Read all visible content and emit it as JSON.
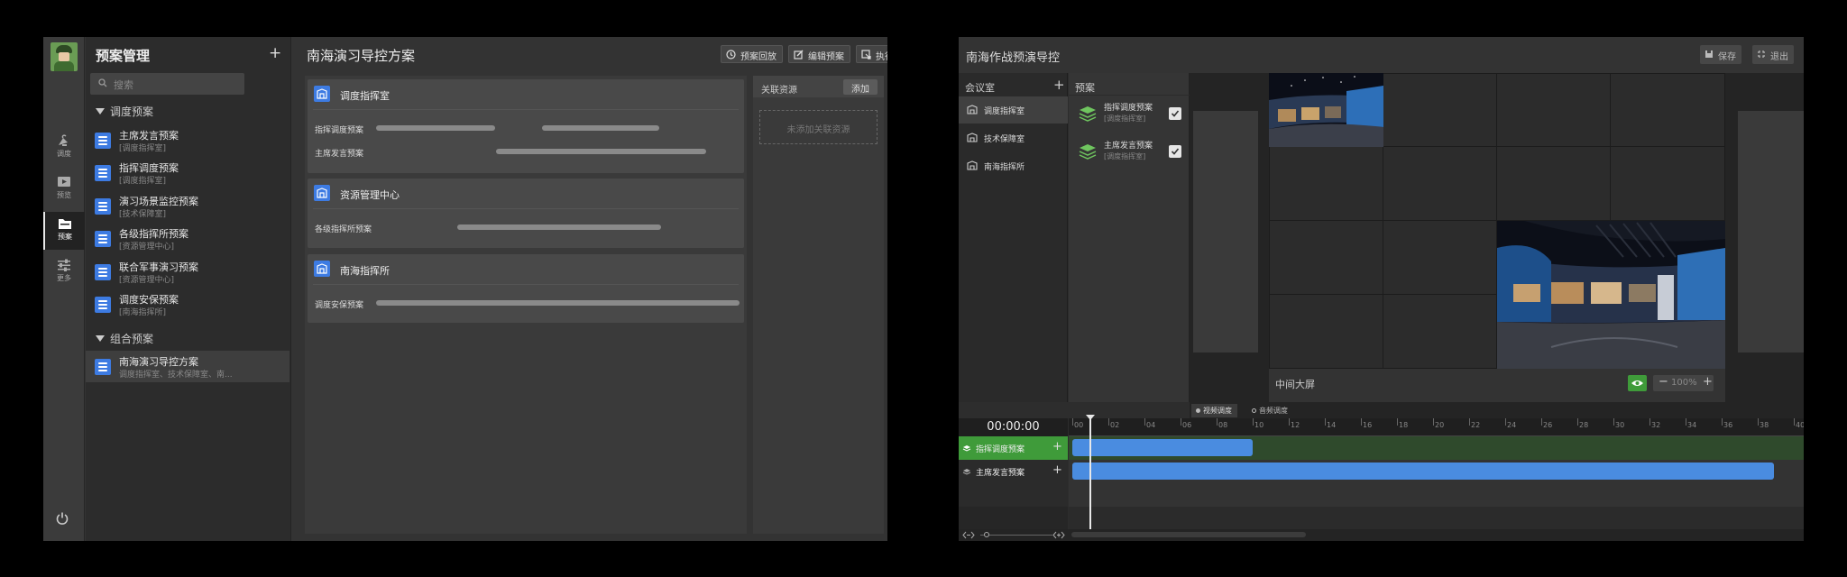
{
  "left": {
    "rail": {
      "items": [
        {
          "label": "调度",
          "icon": "satellite-dish-icon"
        },
        {
          "label": "预览",
          "icon": "play-screen-icon"
        },
        {
          "label": "预案",
          "icon": "folder-icon"
        },
        {
          "label": "更多",
          "icon": "sliders-icon"
        }
      ],
      "active_index": 2,
      "power_icon": "power-icon"
    },
    "sidebar": {
      "title": "预案管理",
      "add": "+",
      "search_placeholder": "搜索",
      "group1": {
        "label": "调度预案",
        "items": [
          {
            "name": "主席发言预案",
            "sub": "[调度指挥室]"
          },
          {
            "name": "指挥调度预案",
            "sub": "[调度指挥室]"
          },
          {
            "name": "演习场景监控预案",
            "sub": "[技术保障室]"
          },
          {
            "name": "各级指挥所预案",
            "sub": "[资源管理中心]"
          },
          {
            "name": "联合军事演习预案",
            "sub": "[资源管理中心]"
          },
          {
            "name": "调度安保预案",
            "sub": "[南海指挥所]"
          }
        ]
      },
      "group2": {
        "label": "组合预案",
        "items": [
          {
            "name": "南海演习导控方案",
            "sub": "调度指挥室、技术保障室、南..."
          }
        ]
      }
    },
    "main": {
      "title": "南海演习导控方案",
      "buttons": {
        "replay": "预案回放",
        "edit": "编辑预案",
        "execute": "执行预案"
      },
      "cards": [
        {
          "title": "调度指挥室",
          "rows": [
            "指挥调度预案",
            "主席发言预案"
          ]
        },
        {
          "title": "资源管理中心",
          "rows": [
            "各级指挥所预案"
          ]
        },
        {
          "title": "南海指挥所",
          "rows": [
            "调度安保预案"
          ]
        }
      ],
      "related": {
        "title": "关联资源",
        "add": "添加",
        "empty": "未添加关联资源"
      }
    }
  },
  "right": {
    "title": "南海作战预演导控",
    "buttons": {
      "save": "保存",
      "exit": "退出"
    },
    "rooms": {
      "header": "会议室",
      "add": "+",
      "items": [
        "调度指挥室",
        "技术保障室",
        "南海指挥所"
      ],
      "selected_index": 0
    },
    "plans": {
      "header": "预案",
      "items": [
        {
          "name": "指挥调度预案",
          "sub": "[调度指挥室]",
          "checked": true
        },
        {
          "name": "主席发言预案",
          "sub": "[调度指挥室]",
          "checked": true
        }
      ]
    },
    "screen": {
      "label": "中间大屏",
      "zoom": "100%",
      "zoom_minus": "−",
      "zoom_plus": "+"
    },
    "tabs": [
      "视频调度",
      "音频调度"
    ],
    "timeline": {
      "clock": "00:00:00",
      "ticks": [
        "00",
        "02",
        "04",
        "06",
        "08",
        "10",
        "12",
        "14",
        "16",
        "18",
        "20",
        "22",
        "24",
        "26",
        "28",
        "30",
        "32",
        "34",
        "36",
        "38",
        "40"
      ],
      "tracks": [
        {
          "name": "指挥调度预案",
          "start": 0,
          "end": 10,
          "active": true
        },
        {
          "name": "主席发言预案",
          "start": 0,
          "end": 40,
          "active": false
        }
      ],
      "playhead": 1
    },
    "colors": {
      "accent_blue": "#4a8ce0",
      "active_green": "#3f9b3a"
    }
  }
}
